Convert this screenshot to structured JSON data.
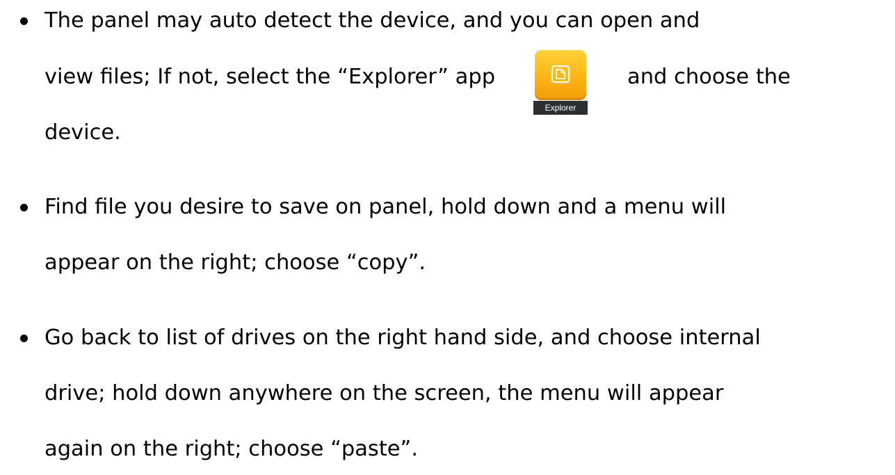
{
  "bullets": [
    {
      "lines": [
        "The panel may auto detect the device, and you can open and",
        "view files; If not, select the “Explorer” app",
        "device."
      ],
      "after_icon": "and choose the"
    },
    {
      "lines": [
        "Find file you desire to save on panel, hold down and a menu will",
        "appear on the right; choose “copy”."
      ]
    },
    {
      "lines": [
        "Go back to list of drives on the right hand side, and choose internal",
        "drive; hold down anywhere on the screen, the menu will appear",
        "again on the right; choose “paste”."
      ]
    }
  ],
  "app_icon": {
    "label": "Explorer",
    "icon": "folder-icon",
    "tile_color": "#ffb515",
    "label_bg": "#2d3033"
  }
}
